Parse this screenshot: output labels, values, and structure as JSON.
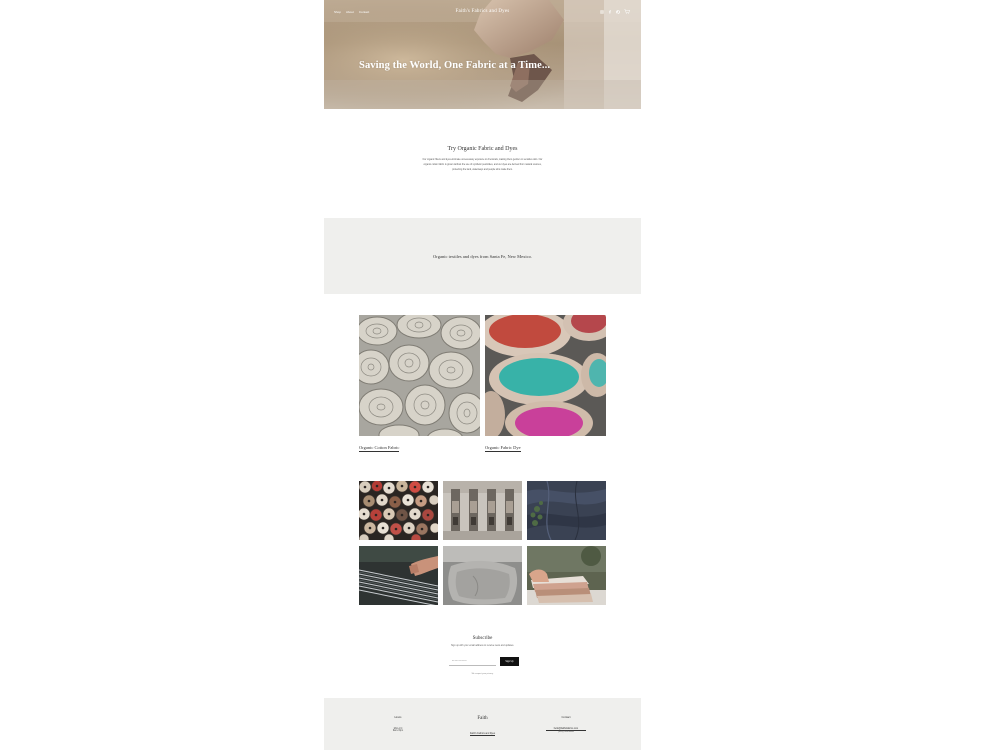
{
  "nav": {
    "items": [
      "Shop",
      "About",
      "Contact"
    ]
  },
  "brand": {
    "name": "Faith's Fabrics and Dyes"
  },
  "icons": [
    "instagram-icon",
    "facebook-icon",
    "pinterest-icon",
    "cart-icon"
  ],
  "hero": {
    "title": "Saving the World, One Fabric at a Time..."
  },
  "intro": {
    "heading": "Try Organic Fabric and Dyes",
    "body": "Our organic fibers and dyes eliminate unnecessary exposure to chemicals, making them gentler on sensitive skin. Our organic cotton fabric is grown without the use of synthetic pesticides, and our dyes are derived from natural sources, protecting the land, waterways and people who make them."
  },
  "band": {
    "text": "Organic textiles and dyes from Santa Fe, New Mexico."
  },
  "products": [
    {
      "label": "Organic Cotton Fabric"
    },
    {
      "label": "Organic Fabric Dye"
    }
  ],
  "subscribe": {
    "title": "Subscribe",
    "description": "Sign up with your email address to receive news and updates.",
    "placeholder": "Email Address",
    "button": "Sign Up",
    "note": "We respect your privacy."
  },
  "footer": {
    "left": {
      "title": "Hours",
      "lines": [
        "Mon–Fri",
        "9am–5pm"
      ]
    },
    "center": {
      "name": "Faith",
      "link": "Faith's Fabrics and Dyes"
    },
    "right": {
      "title": "Contact",
      "lines": [
        "hello@faithsfabrics.com",
        "(505) 555-0000"
      ]
    }
  },
  "colors": {
    "band_bg": "#efefed",
    "button_bg": "#111111",
    "hero_tone": "#a89378"
  }
}
